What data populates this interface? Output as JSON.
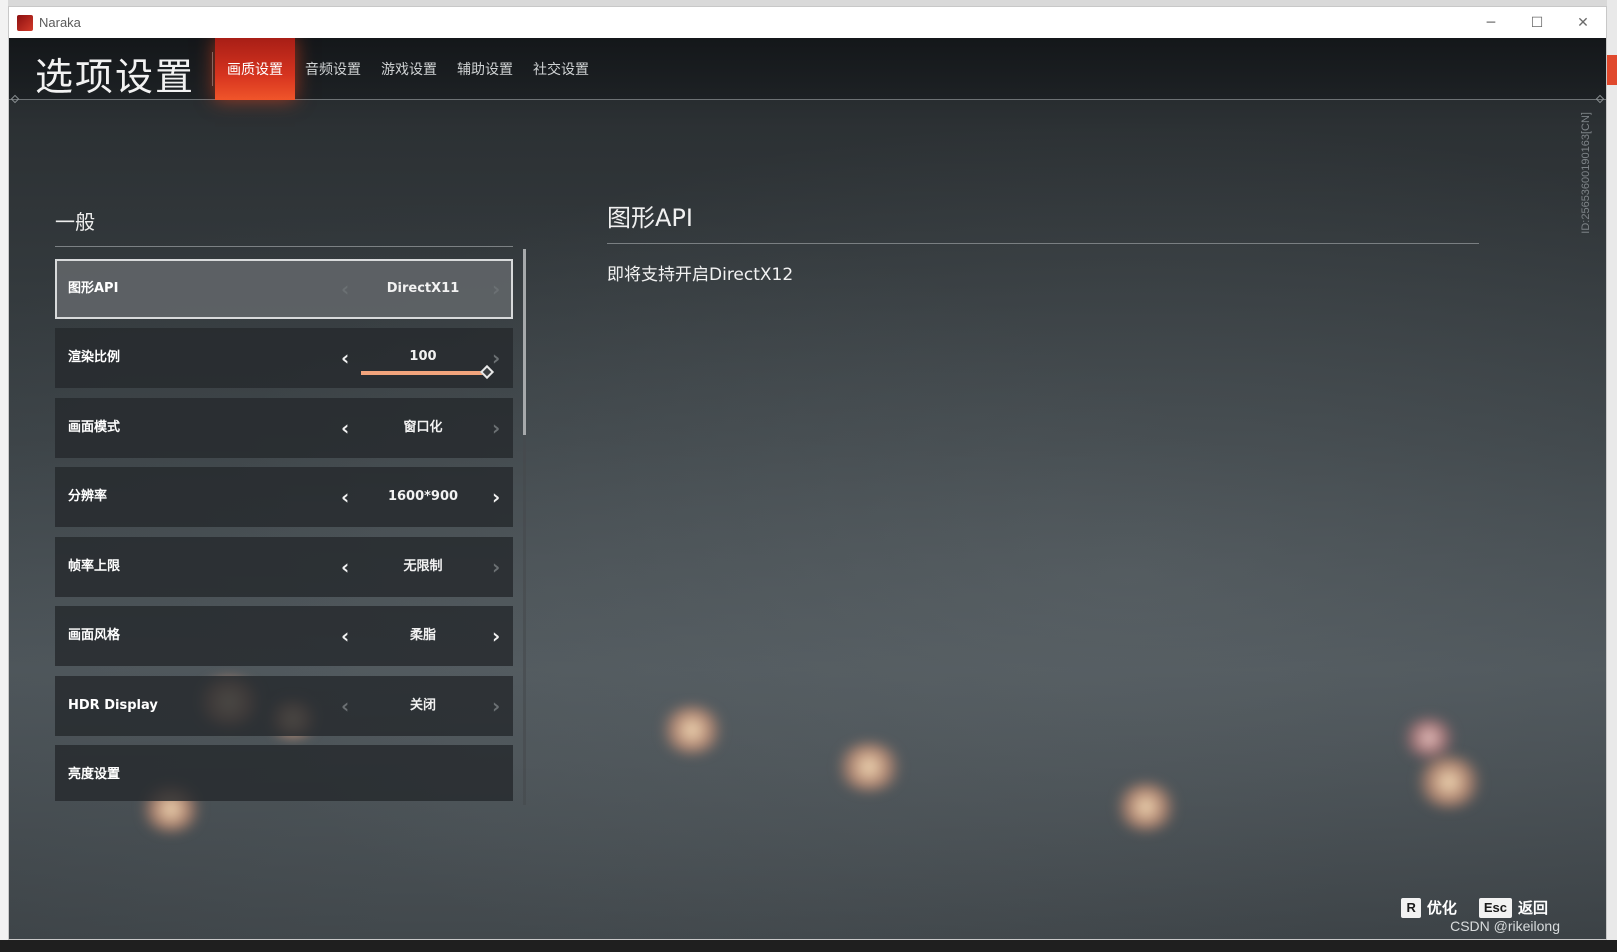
{
  "window": {
    "title": "Naraka",
    "controls": {
      "minimize": "─",
      "maximize": "☐",
      "close": "✕"
    }
  },
  "header": {
    "page_title": "选项设置",
    "tabs": [
      {
        "label": "画质设置",
        "active": true
      },
      {
        "label": "音频设置",
        "active": false
      },
      {
        "label": "游戏设置",
        "active": false
      },
      {
        "label": "辅助设置",
        "active": false
      },
      {
        "label": "社交设置",
        "active": false
      }
    ]
  },
  "section": {
    "title": "一般",
    "settings": [
      {
        "label": "图形API",
        "value": "DirectX11",
        "left_enabled": false,
        "right_enabled": false,
        "selected": true
      },
      {
        "label": "渲染比例",
        "value": "100",
        "left_enabled": true,
        "right_enabled": false,
        "slider_fraction": 1.0
      },
      {
        "label": "画面模式",
        "value": "窗口化",
        "left_enabled": true,
        "right_enabled": false
      },
      {
        "label": "分辨率",
        "value": "1600*900",
        "left_enabled": true,
        "right_enabled": true
      },
      {
        "label": "帧率上限",
        "value": "无限制",
        "left_enabled": true,
        "right_enabled": false
      },
      {
        "label": "画面风格",
        "value": "柔脂",
        "left_enabled": true,
        "right_enabled": true
      },
      {
        "label": "HDR Display",
        "value": "关闭",
        "left_enabled": false,
        "right_enabled": false
      },
      {
        "label": "亮度设置",
        "value": ""
      }
    ]
  },
  "detail": {
    "title": "图形API",
    "description": "即将支持开启DirectX12"
  },
  "build_id": "ID:2565360019016​3[CN]",
  "footer": {
    "optimize_key": "R",
    "optimize_label": "优化",
    "back_key": "Esc",
    "back_label": "返回"
  },
  "watermark": "CSDN @rikeilong",
  "colors": {
    "accent_tab": "#d6341f",
    "slider_fill": "#f2a47c",
    "row_bg": "#262a2d",
    "selected_border": "#d8dadb"
  },
  "icons": {
    "arrow_left": "chevron-left-icon",
    "arrow_right": "chevron-right-icon"
  }
}
